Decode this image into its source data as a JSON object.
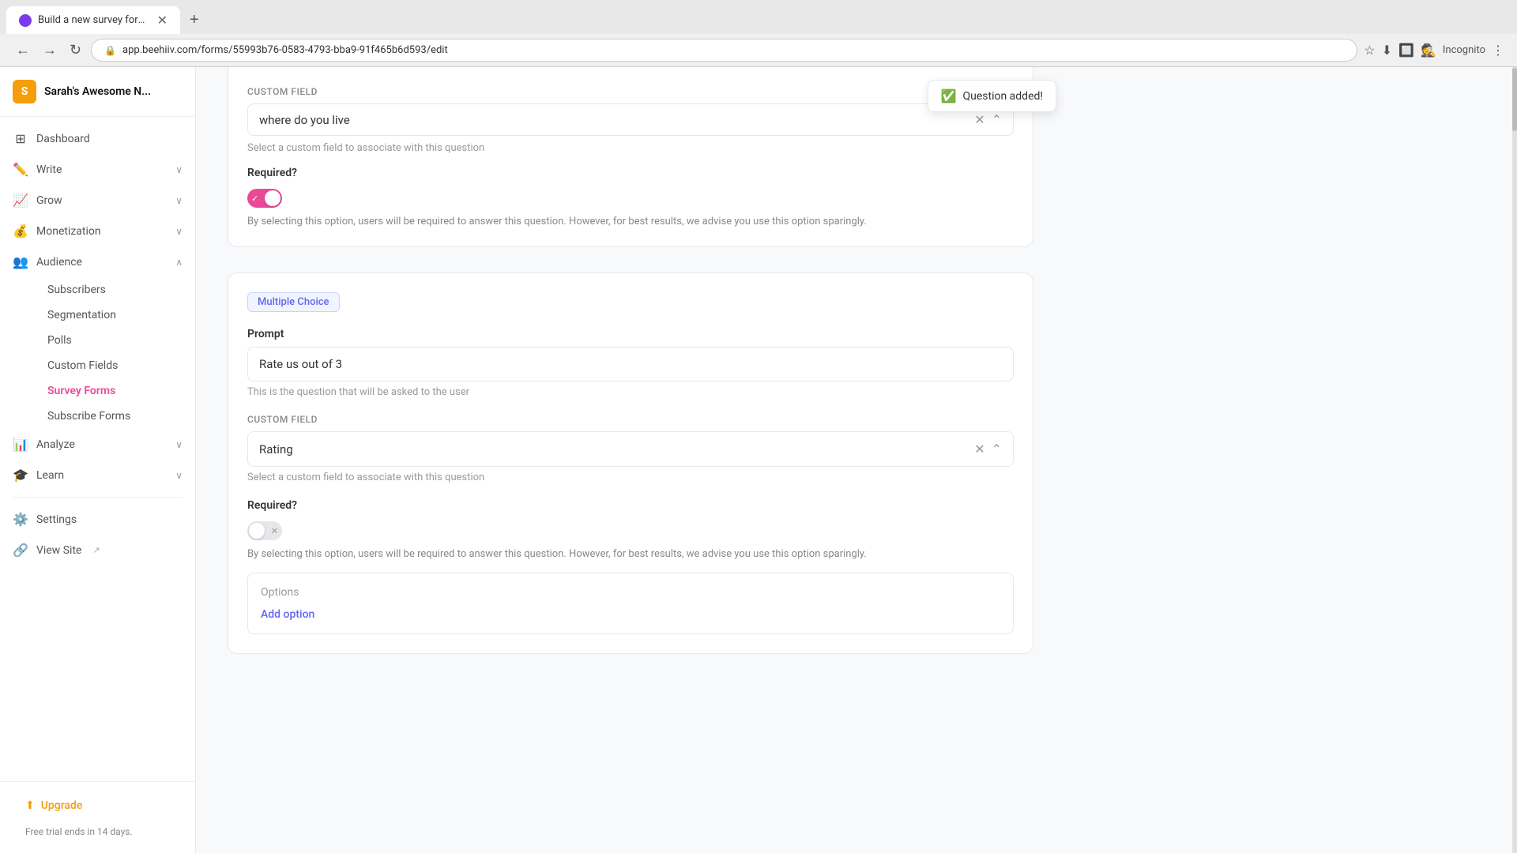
{
  "browser": {
    "tab_title": "Build a new survey form - Sarah...",
    "tab_new_label": "+",
    "address": "app.beehiiv.com/forms/55993b76-0583-4793-bba9-91f465b6d593/edit",
    "incognito_label": "Incognito"
  },
  "sidebar": {
    "brand_initial": "S",
    "brand_name": "Sarah's Awesome N...",
    "nav_items": [
      {
        "id": "dashboard",
        "label": "Dashboard",
        "icon": "⊞",
        "expandable": false
      },
      {
        "id": "write",
        "label": "Write",
        "icon": "✏️",
        "expandable": true
      },
      {
        "id": "grow",
        "label": "Grow",
        "icon": "📈",
        "expandable": true
      },
      {
        "id": "monetization",
        "label": "Monetization",
        "icon": "💰",
        "expandable": true
      },
      {
        "id": "audience",
        "label": "Audience",
        "icon": "👥",
        "expandable": true,
        "expanded": true
      },
      {
        "id": "analyze",
        "label": "Analyze",
        "icon": "📊",
        "expandable": true
      },
      {
        "id": "learn",
        "label": "Learn",
        "icon": "🎓",
        "expandable": true
      },
      {
        "id": "settings",
        "label": "Settings",
        "icon": "⚙️",
        "expandable": false
      },
      {
        "id": "view-site",
        "label": "View Site",
        "icon": "🔗",
        "expandable": false
      }
    ],
    "audience_sub_items": [
      {
        "id": "subscribers",
        "label": "Subscribers",
        "active": false
      },
      {
        "id": "segmentation",
        "label": "Segmentation",
        "active": false
      },
      {
        "id": "polls",
        "label": "Polls",
        "active": false
      },
      {
        "id": "custom-fields",
        "label": "Custom Fields",
        "active": false
      },
      {
        "id": "survey-forms",
        "label": "Survey Forms",
        "active": true
      },
      {
        "id": "subscribe-forms",
        "label": "Subscribe Forms",
        "active": false
      }
    ],
    "upgrade_label": "Upgrade",
    "free_trial_text": "Free trial ends in 14 days."
  },
  "content": {
    "card1": {
      "custom_field_label": "Custom Field",
      "question_text": "where do you live",
      "toast_text": "Question added!",
      "helper_text": "Select a custom field to associate with this question",
      "required_label": "Required?",
      "required_on": true,
      "required_desc": "By selecting this option, users will be required to answer this question. However, for best results, we advise you use this option sparingly."
    },
    "card2": {
      "question_type_badge": "Multiple Choice",
      "prompt_label": "Prompt",
      "prompt_value": "Rate us out of 3",
      "prompt_helper": "This is the question that will be asked to the user",
      "custom_field_label": "Custom Field",
      "custom_field_value": "Rating",
      "custom_field_helper": "Select a custom field to associate with this question",
      "required_label": "Required?",
      "required_on": false,
      "required_desc": "By selecting this option, users will be required to answer this question. However, for best results, we advise you use this option sparingly.",
      "options_title": "Options",
      "add_option_label": "Add option"
    }
  }
}
